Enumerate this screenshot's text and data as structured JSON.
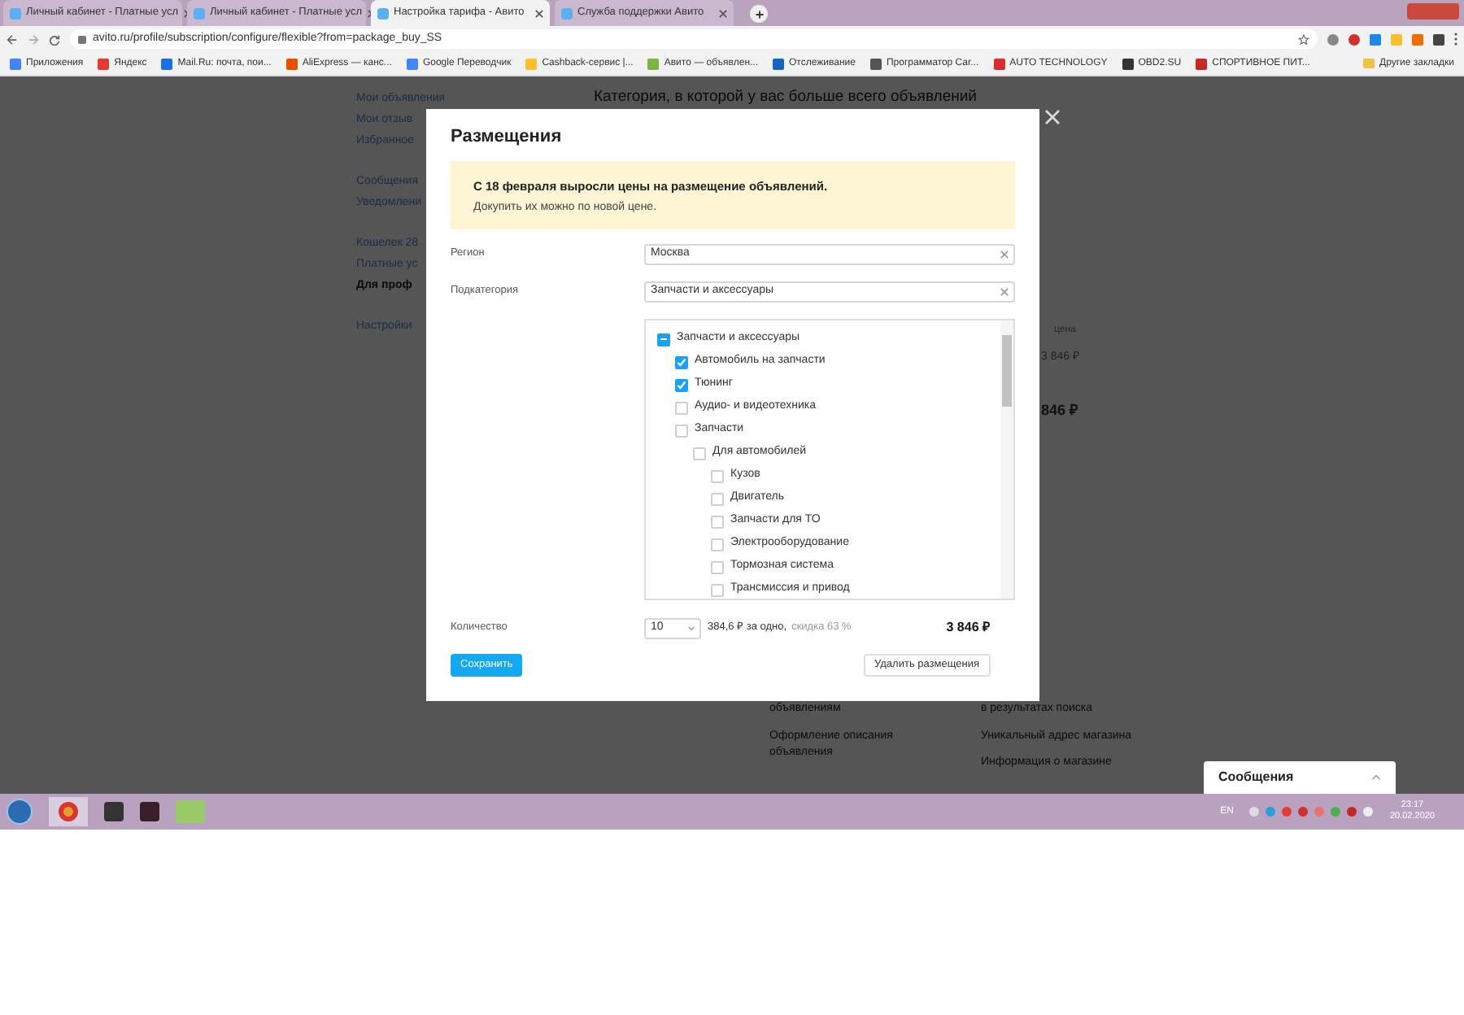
{
  "browser": {
    "tabs": [
      {
        "title": "Личный кабинет - Платные усл",
        "selected": false
      },
      {
        "title": "Личный кабинет - Платные усл",
        "selected": false
      },
      {
        "title": "Настройка тарифа - Авито",
        "selected": true
      },
      {
        "title": "Служба поддержки Авито",
        "selected": false
      }
    ],
    "url": "avito.ru/profile/subscription/configure/flexible?from=package_buy_SS",
    "bookmarks": [
      {
        "label": "Приложения"
      },
      {
        "label": "Яндекс"
      },
      {
        "label": "Mail.Ru: почта, пои..."
      },
      {
        "label": "AliExpress — канс..."
      },
      {
        "label": "Google Переводчик"
      },
      {
        "label": "Cashback-сервис |..."
      },
      {
        "label": "Авито — объявлен..."
      },
      {
        "label": "Отслеживание"
      },
      {
        "label": "Программатор Car..."
      },
      {
        "label": "AUTO TECHNOLOGY"
      },
      {
        "label": "OBD2.SU"
      },
      {
        "label": "СПОРТИВНОЕ ПИТ..."
      }
    ],
    "other_bookmarks": "Другие закладки"
  },
  "background": {
    "nav": [
      {
        "label": "Мои объявления",
        "bold": false
      },
      {
        "label": "Мои отзыв",
        "bold": false
      },
      {
        "label": "Избранное",
        "bold": false
      },
      {
        "label": "Сообщения",
        "bold": false
      },
      {
        "label": "Уведомлени",
        "bold": false
      },
      {
        "label": "Кошелек 28",
        "bold": false
      },
      {
        "label": "Платные ус",
        "bold": false
      },
      {
        "label": "Для проф",
        "bold": true
      },
      {
        "label": "Настройки",
        "bold": false
      }
    ],
    "heading": "Категория, в которой у вас больше всего объявлений",
    "price_label": "цена",
    "price": "3 846 ₽",
    "total": "846 ₽",
    "features_left": [
      "объявлениям",
      "Оформление описания объявления"
    ],
    "features_right": [
      "в результатах поиска",
      "Уникальный адрес магазина",
      "Информация о магазине"
    ]
  },
  "modal": {
    "title": "Размещения",
    "notice": {
      "headline": "С 18 февраля выросли цены на размещение объявлений.",
      "text": "Докупить их можно по новой цене."
    },
    "region": {
      "label": "Регион",
      "value": "Москва"
    },
    "subcategory": {
      "label": "Подкатегория",
      "value": "Запчасти и аксессуары"
    },
    "tree": [
      {
        "label": "Запчасти и аксессуары",
        "checked": false,
        "partial": true,
        "children": [
          {
            "label": "Автомобиль на запчасти",
            "checked": true,
            "partial": false
          },
          {
            "label": "Тюнинг",
            "checked": true,
            "partial": false
          },
          {
            "label": "Аудио- и видеотехника",
            "checked": false,
            "partial": false
          },
          {
            "label": "Запчасти",
            "checked": false,
            "partial": false,
            "children": [
              {
                "label": "Для автомобилей",
                "checked": false,
                "partial": false,
                "children": [
                  {
                    "label": "Кузов",
                    "checked": false,
                    "partial": false
                  },
                  {
                    "label": "Двигатель",
                    "checked": false,
                    "partial": false
                  },
                  {
                    "label": "Запчасти для ТО",
                    "checked": false,
                    "partial": false
                  },
                  {
                    "label": "Электрооборудование",
                    "checked": false,
                    "partial": false
                  },
                  {
                    "label": "Тормозная система",
                    "checked": false,
                    "partial": false
                  },
                  {
                    "label": "Трансмиссия и привод",
                    "checked": false,
                    "partial": false
                  }
                ]
              }
            ]
          }
        ]
      }
    ],
    "quantity": {
      "label": "Количество",
      "value": "10",
      "unit_price": "384,6 ₽ за одно,",
      "discount": "скидка 63 %",
      "total": "3 846 ₽"
    },
    "save_button": "Сохранить",
    "delete_button": "Удалить размещения"
  },
  "messages_widget": {
    "title": "Сообщения"
  },
  "taskbar": {
    "language": "EN",
    "time": "23:17",
    "date": "20.02.2020"
  }
}
